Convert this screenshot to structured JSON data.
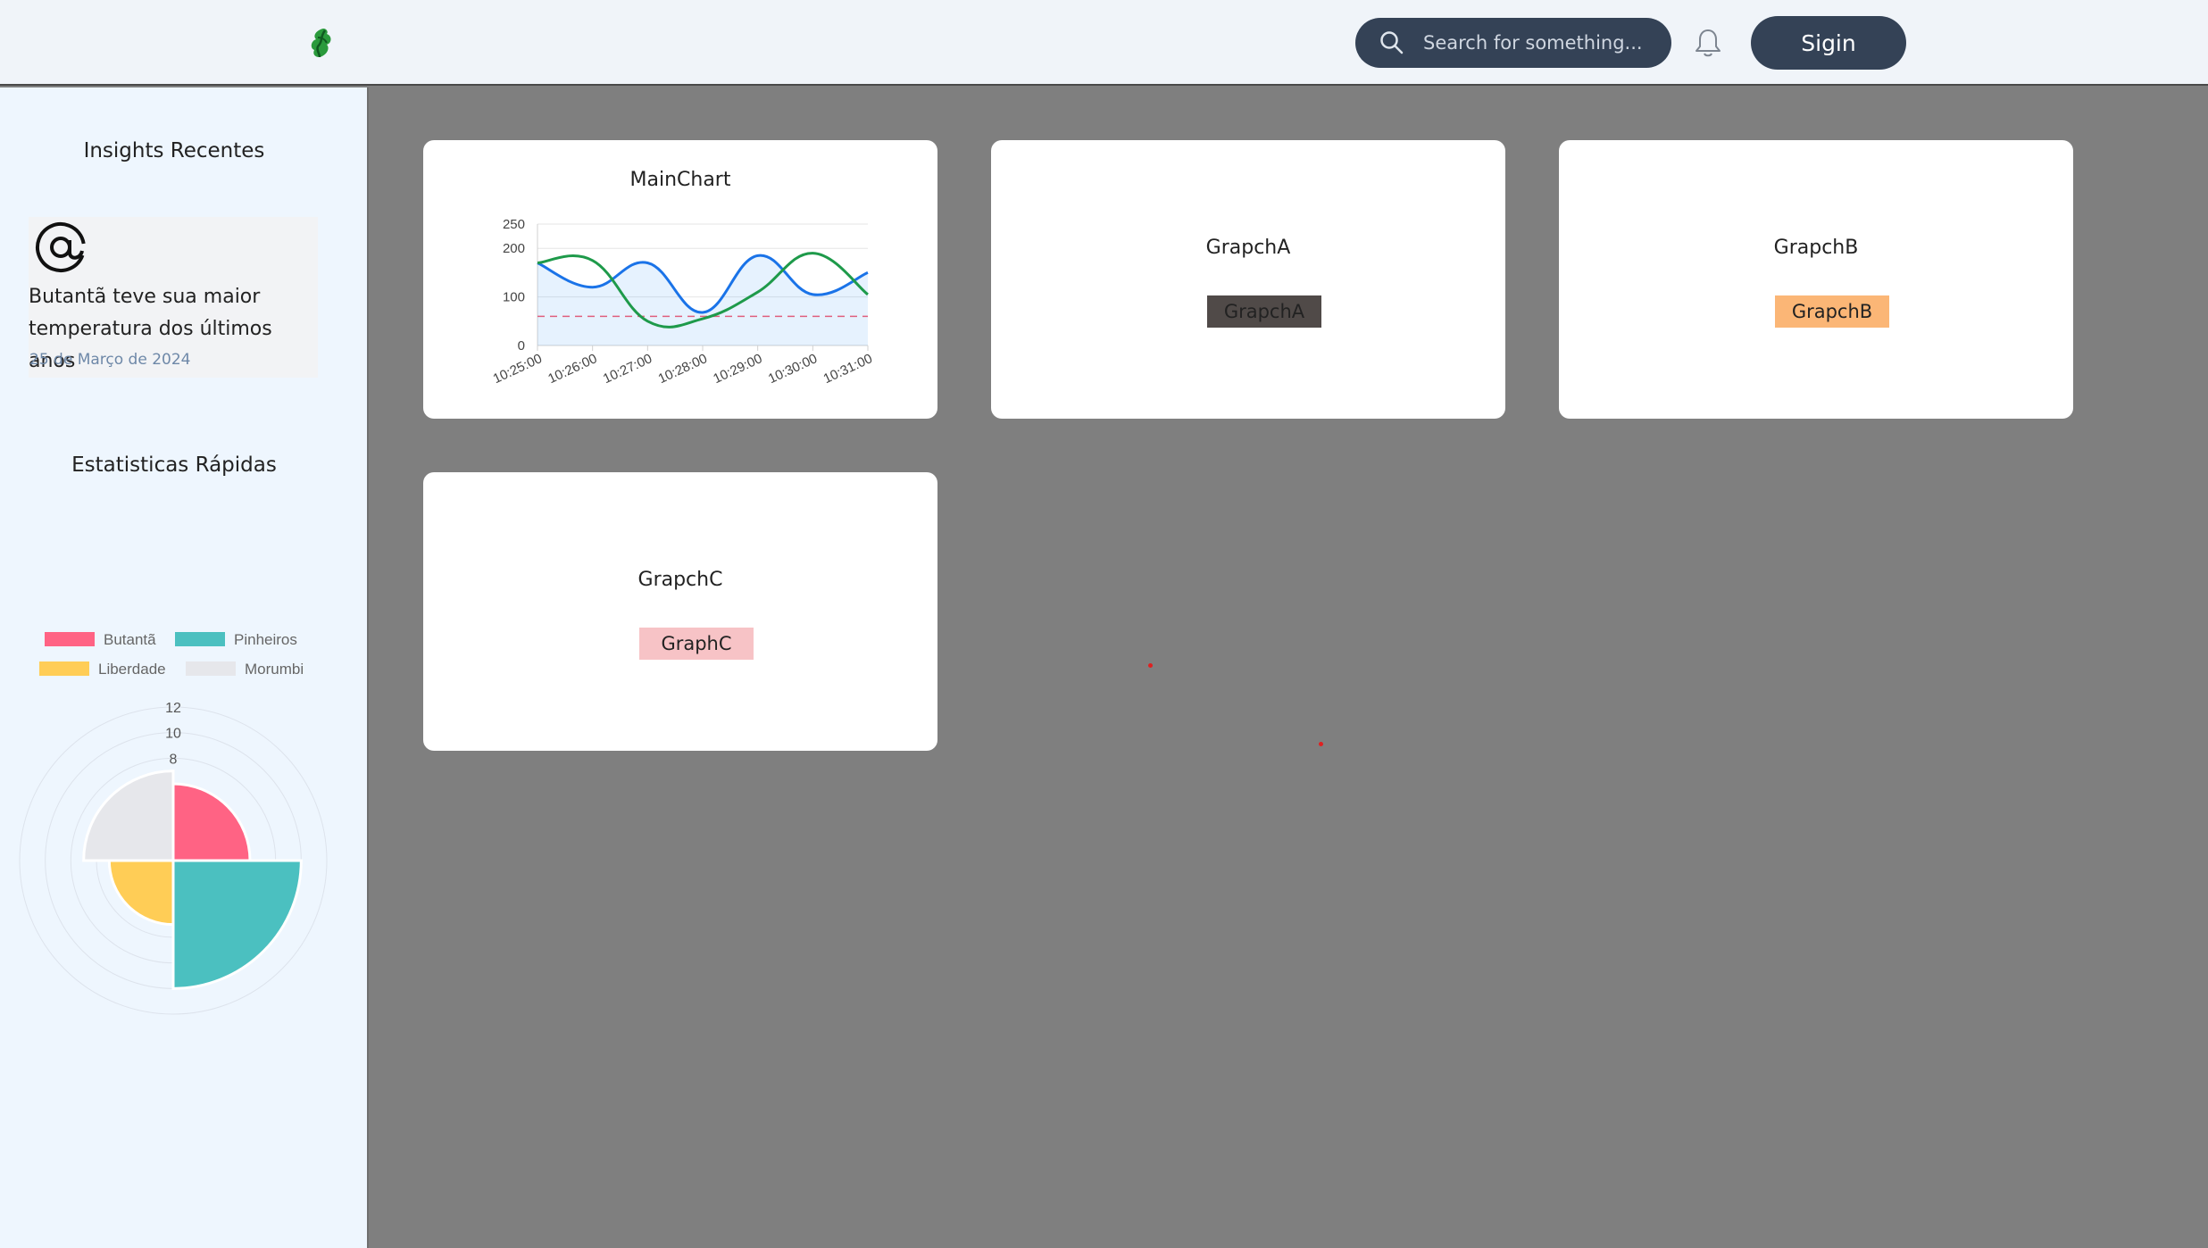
{
  "header": {
    "logo_icon": "leaf-logo-icon",
    "search_placeholder": "Search for something...",
    "notifications_icon": "bell-icon",
    "signin_label": "Sigin"
  },
  "sidebar": {
    "insights_title": "Insights Recentes",
    "insight": {
      "icon": "at-sign-icon",
      "text": "Butantã teve sua maior temperatura dos últimos anos",
      "date": "25 de Março de 2024"
    },
    "stats_title": "Estatisticas Rápidas"
  },
  "cards": {
    "main": {
      "title": "MainChart"
    },
    "a": {
      "title": "GrapchA",
      "pill": "GrapchA",
      "pill_color": "#504a48"
    },
    "b": {
      "title": "GrapchB",
      "pill": "GrapchB",
      "pill_color": "#fbb676"
    },
    "c": {
      "title": "GrapchC",
      "pill": "GraphC",
      "pill_color": "#f7c3c6"
    }
  },
  "colors": {
    "nav": "#344256",
    "background": "#7f7f7f",
    "sidebar": "#eef6fe"
  },
  "chart_data": [
    {
      "type": "line",
      "x": [
        "10:25:00",
        "10:26:00",
        "10:27:00",
        "10:28:00",
        "10:29:00",
        "10:30:00",
        "10:31:00"
      ],
      "series": [
        {
          "values": [
            170,
            120,
            170,
            68,
            185,
            105,
            150
          ],
          "color": "#1a73e8",
          "fill": "rgba(46,144,250,0.12)"
        },
        {
          "values": [
            170,
            175,
            50,
            55,
            110,
            190,
            105
          ],
          "color": "#1e9a4a"
        }
      ],
      "reference_line": {
        "value": 60,
        "color": "#e0607e",
        "style": "dashed"
      },
      "yticks": [
        0,
        100,
        200,
        250
      ],
      "ylim": [
        0,
        250
      ],
      "grid": true
    },
    {
      "type": "pie",
      "subtype": "polar-area",
      "categories": [
        "Butantã",
        "Pinheiros",
        "Liberdade",
        "Morumbi"
      ],
      "values": [
        6,
        10,
        5,
        7
      ],
      "colors": [
        "#ff6384",
        "#4bc0c0",
        "#ffcd56",
        "#e6e7eb"
      ],
      "rticks": [
        8,
        10,
        12
      ],
      "rlim": [
        0,
        12
      ],
      "legend": "top"
    }
  ]
}
